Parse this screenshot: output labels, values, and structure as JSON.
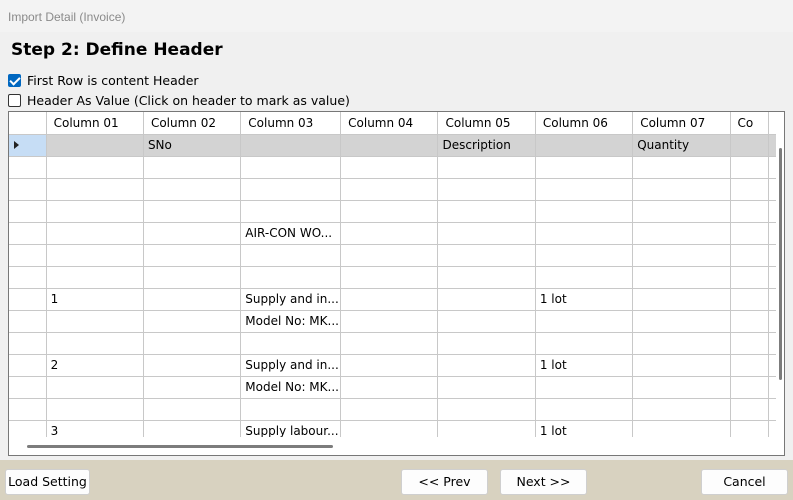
{
  "window": {
    "title": "Import Detail (Invoice)"
  },
  "heading": "Step 2: Define Header",
  "options": {
    "first_row_header": {
      "label": "First Row is content Header",
      "checked": true
    },
    "header_as_value": {
      "label": "Header As Value (Click on header to mark as value)",
      "checked": false
    }
  },
  "grid": {
    "columns": [
      "Column 01",
      "Column 02",
      "Column 03",
      "Column 04",
      "Column 05",
      "Column 06",
      "Column 07",
      "Co"
    ],
    "rows": [
      [
        "",
        "SNo",
        "",
        "",
        "Description",
        "",
        "Quantity",
        ""
      ],
      [
        "",
        "",
        "",
        "",
        "",
        "",
        "",
        ""
      ],
      [
        "",
        "",
        "",
        "",
        "",
        "",
        "",
        ""
      ],
      [
        "",
        "",
        "",
        "",
        "",
        "",
        "",
        ""
      ],
      [
        "",
        "",
        "AIR-CON WO...",
        "",
        "",
        "",
        "",
        ""
      ],
      [
        "",
        "",
        "",
        "",
        "",
        "",
        "",
        ""
      ],
      [
        "",
        "",
        "",
        "",
        "",
        "",
        "",
        ""
      ],
      [
        "1",
        "",
        "Supply and in...",
        "",
        "",
        "1 lot",
        "",
        ""
      ],
      [
        "",
        "",
        "Model No: MK...",
        "",
        "",
        "",
        "",
        ""
      ],
      [
        "",
        "",
        "",
        "",
        "",
        "",
        "",
        ""
      ],
      [
        "2",
        "",
        "Supply and in...",
        "",
        "",
        "1 lot",
        "",
        ""
      ],
      [
        "",
        "",
        "Model No: MK...",
        "",
        "",
        "",
        "",
        ""
      ],
      [
        "",
        "",
        "",
        "",
        "",
        "",
        "",
        ""
      ],
      [
        "3",
        "",
        "Supply labour...",
        "",
        "",
        "1 lot",
        "",
        ""
      ]
    ],
    "selected_row": 0
  },
  "buttons": {
    "load_setting": "Load Setting",
    "prev": "<< Prev",
    "next": "Next >>",
    "cancel": "Cancel"
  },
  "colors": {
    "accent": "#0067c0",
    "selected_row": "#d3d3d3",
    "footer": "#d8d2c0"
  }
}
